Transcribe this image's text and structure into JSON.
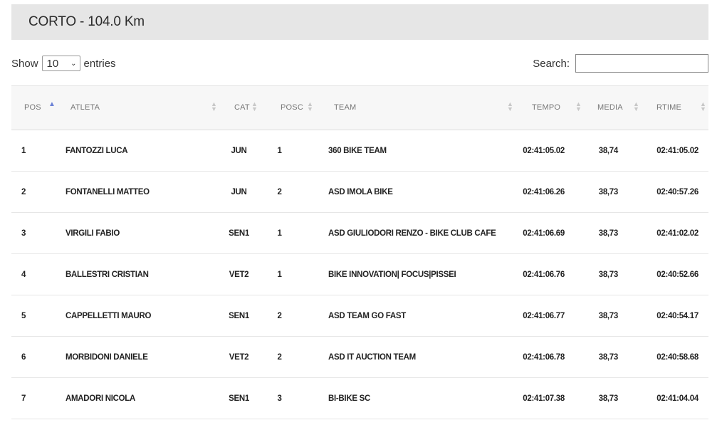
{
  "title": "CORTO - 104.0 Km",
  "controls": {
    "show_label": "Show",
    "entries_value": "10",
    "entries_label": "entries",
    "search_label": "Search:",
    "search_value": ""
  },
  "columns": [
    "POS",
    "ATLETA",
    "CAT",
    "POSC",
    "TEAM",
    "TEMPO",
    "MEDIA",
    "RTIME"
  ],
  "sorted_column": "POS",
  "rows": [
    {
      "pos": "1",
      "atleta": "FANTOZZI LUCA",
      "cat": "JUN",
      "posc": "1",
      "team": "360 BIKE TEAM",
      "tempo": "02:41:05.02",
      "media": "38,74",
      "rtime": "02:41:05.02"
    },
    {
      "pos": "2",
      "atleta": "FONTANELLI MATTEO",
      "cat": "JUN",
      "posc": "2",
      "team": "ASD IMOLA BIKE",
      "tempo": "02:41:06.26",
      "media": "38,73",
      "rtime": "02:40:57.26"
    },
    {
      "pos": "3",
      "atleta": "VIRGILI FABIO",
      "cat": "SEN1",
      "posc": "1",
      "team": "ASD GIULIODORI RENZO - BIKE CLUB CAFE",
      "tempo": "02:41:06.69",
      "media": "38,73",
      "rtime": "02:41:02.02"
    },
    {
      "pos": "4",
      "atleta": "BALLESTRI CRISTIAN",
      "cat": "VET2",
      "posc": "1",
      "team": "BIKE INNOVATION| FOCUS|PISSEI",
      "tempo": "02:41:06.76",
      "media": "38,73",
      "rtime": "02:40:52.66"
    },
    {
      "pos": "5",
      "atleta": "CAPPELLETTI MAURO",
      "cat": "SEN1",
      "posc": "2",
      "team": "ASD TEAM GO FAST",
      "tempo": "02:41:06.77",
      "media": "38,73",
      "rtime": "02:40:54.17"
    },
    {
      "pos": "6",
      "atleta": "MORBIDONI DANIELE",
      "cat": "VET2",
      "posc": "2",
      "team": "ASD IT AUCTION TEAM",
      "tempo": "02:41:06.78",
      "media": "38,73",
      "rtime": "02:40:58.68"
    },
    {
      "pos": "7",
      "atleta": "AMADORI NICOLA",
      "cat": "SEN1",
      "posc": "3",
      "team": "BI-BIKE SC",
      "tempo": "02:41:07.38",
      "media": "38,73",
      "rtime": "02:41:04.04"
    }
  ]
}
